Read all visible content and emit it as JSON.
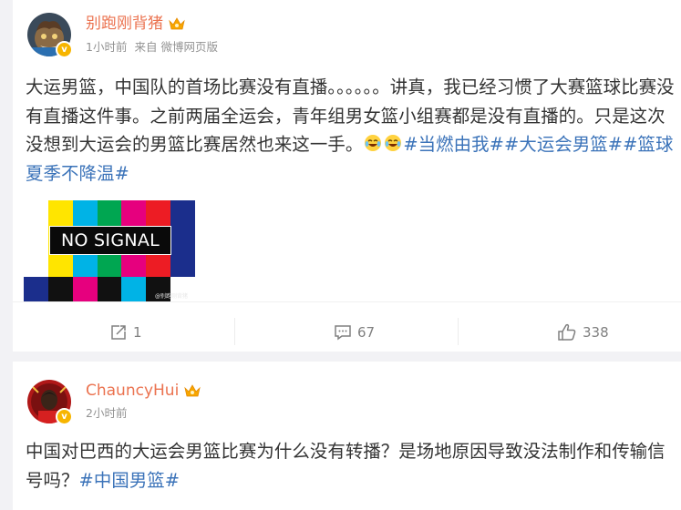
{
  "posts": [
    {
      "author": "别跑刚背猪",
      "time": "1小时前",
      "source_prefix": "来自",
      "source": "微博网页版",
      "text_main": "大运男篮，中国队的首场比赛没有直播。。。。。。讲真，我已经习惯了大赛篮球比赛没有直播这件事。之前两届全运会，青年组男女篮小组赛都是没有直播的。只是这次没想到大运会的男篮比赛居然也来这一手。",
      "topics": [
        "#当燃由我#",
        "#大运会男篮#",
        "#篮球夏季不降温#"
      ],
      "emojis": [
        "laugh-cry-emoji",
        "laugh-cry-emoji"
      ],
      "image": {
        "label": "NO SIGNAL",
        "watermark": "@别跑刚背猪",
        "bar_colors": [
          "#ffffff",
          "#ffe500",
          "#00b3e6",
          "#00a651",
          "#e6007e",
          "#ed1c24",
          "#1b2e8c"
        ],
        "bottom_colors": [
          "#1b2e8c",
          "#111111",
          "#e6007e",
          "#111111",
          "#00b3e6",
          "#111111",
          "#ffffff"
        ]
      },
      "actions": {
        "repost": "1",
        "comment": "67",
        "like": "338"
      }
    },
    {
      "author": "ChauncyHui",
      "time": "2小时前",
      "text_main": "中国对巴西的大运会男篮比赛为什么没有转播？是场地原因导致没法制作和传输信号吗？",
      "topics": [
        "#中国男篮#"
      ]
    }
  ],
  "colors": {
    "name": "#eb7350",
    "topic": "#3b73b9",
    "meta": "#939393",
    "badge": "#f7b500"
  }
}
